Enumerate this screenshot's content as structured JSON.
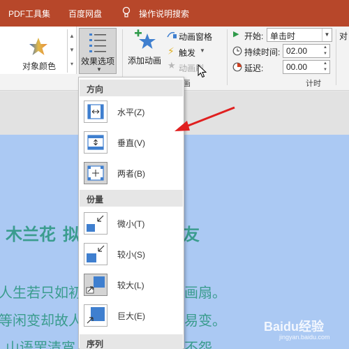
{
  "titlebar": {
    "tabs": [
      "PDF工具集",
      "百度网盘"
    ],
    "tell_me": "操作说明搜索",
    "color": "#b7472a"
  },
  "ribbon": {
    "gallery_label": "对象颜色",
    "effect_options_label": "效果选项",
    "add_animation_label": "添加动画",
    "animation_pane_label": "动画窗格",
    "trigger_label": "触发",
    "animation_painter_label": "动画刷",
    "group_animation_label": "画",
    "timing": {
      "start_label": "开始:",
      "start_value": "单击时",
      "duration_label": "持续时间:",
      "duration_value": "02.00",
      "delay_label": "延迟:",
      "delay_value": "00.00",
      "group_label": "计时",
      "cut_label": "对"
    }
  },
  "dropdown": {
    "sections": {
      "direction": "方向",
      "amount": "份量",
      "sequence": "序列"
    },
    "direction_items": [
      {
        "label": "水平(Z)",
        "icon": "horizontal-arrows-icon",
        "selected": false
      },
      {
        "label": "垂直(V)",
        "icon": "vertical-arrows-icon",
        "selected": false
      },
      {
        "label": "两者(B)",
        "icon": "both-arrows-icon",
        "selected": true
      }
    ],
    "amount_items": [
      {
        "label": "微小(T)",
        "icon": "tiny-icon",
        "selected": false
      },
      {
        "label": "较小(S)",
        "icon": "smaller-icon",
        "selected": false
      },
      {
        "label": "较大(L)",
        "icon": "larger-icon",
        "selected": true
      },
      {
        "label": "巨大(E)",
        "icon": "huge-icon",
        "selected": false
      }
    ]
  },
  "slide": {
    "title_left": "木兰花",
    "title_mid": "拟",
    "title_right": "友",
    "lines": [
      {
        "left": "人生若只如初",
        "right": "画扇。"
      },
      {
        "left": "等闲变却故人",
        "right": "易变。"
      },
      {
        "left": "山语罢清宵",
        "right": "不怨。"
      }
    ],
    "text_color": "#3a9c8e",
    "bg_color": "#abc9f3"
  },
  "watermark": {
    "brand": "Baidu经验",
    "sub": "jingyan.baidu.com"
  },
  "colors": {
    "accent_red": "#e02020",
    "icon_blue": "#3f7fcf"
  }
}
